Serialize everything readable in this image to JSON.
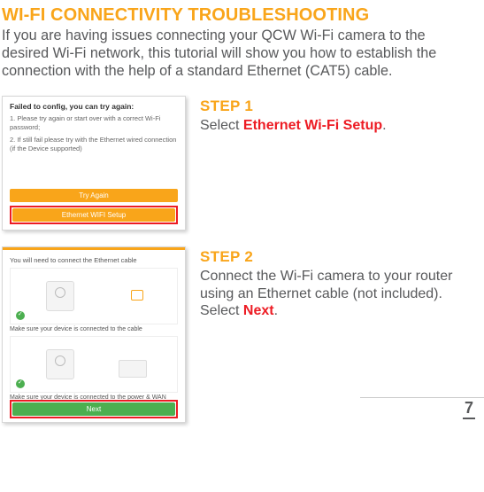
{
  "heading": "WI-FI CONNECTIVITY TROUBLESHOOTING",
  "intro": "If you are having issues connecting your QCW Wi-Fi camera to the desired Wi-Fi network, this tutorial will show you how to establish the connection with the help of a standard Ethernet (CAT5) cable.",
  "steps": [
    {
      "title": "STEP 1",
      "body_pre": "Select ",
      "accent": "Ethernet Wi-Fi Setup",
      "body_post": "."
    },
    {
      "title": "STEP 2",
      "body_pre": "Connect the Wi-Fi camera to your router using an Ethernet cable (not included). Select ",
      "accent": "Next",
      "body_post": "."
    }
  ],
  "screen1": {
    "title": "Failed to config, you can try again:",
    "line1": "1. Please try again or start over with a correct Wi-Fi password;",
    "line2": "2. If still fail please try with the Ethernet wired connection (if the Device supported)",
    "btn_try": "Try Again",
    "btn_eth": "Ethernet WIFI Setup"
  },
  "screen2": {
    "title": "You will need to connect the Ethernet cable",
    "cap1": "Make sure your device is connected to the cable",
    "cap2": "Make sure your device is connected to the power & WAN",
    "btn_next": "Next"
  },
  "page_number": "7"
}
